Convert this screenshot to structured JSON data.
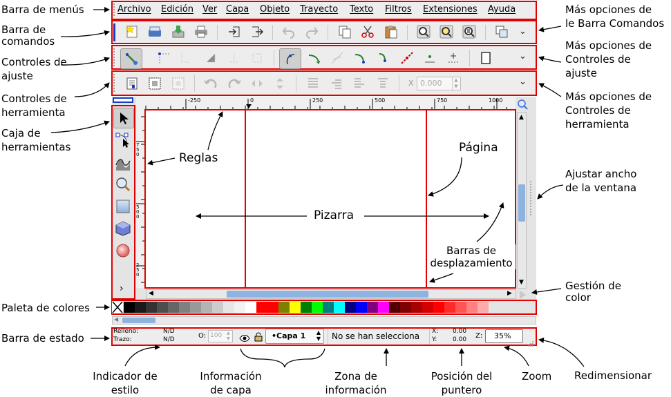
{
  "menu": {
    "items": [
      "Archivo",
      "Edición",
      "Ver",
      "Capa",
      "Objeto",
      "Trayecto",
      "Texto",
      "Filtros",
      "Extensiones",
      "Ayuda"
    ]
  },
  "ruler": {
    "h_ticks": [
      "-250",
      "0",
      "250",
      "500",
      "750",
      "1000"
    ],
    "v_ticks": [
      "750",
      "500",
      "250"
    ]
  },
  "tool_controls": {
    "x_label": "X",
    "x_value": "0.000"
  },
  "statusbar": {
    "fill_label": "Relleno:",
    "fill_value": "N/D",
    "stroke_label": "Trazo:",
    "stroke_value": "N/D",
    "opacity_label": "O:",
    "opacity_value": "100",
    "layer_name": "•Capa 1",
    "message": "No se han selecciona",
    "x_label": "X:",
    "x_value": "0.00",
    "y_label": "Y:",
    "y_value": "0.00",
    "zoom_label": "Z:",
    "zoom_value": "35%"
  },
  "palette": {
    "colors": [
      "#000000",
      "#1a1a1a",
      "#333333",
      "#4d4d4d",
      "#666666",
      "#808080",
      "#999999",
      "#b3b3b3",
      "#cccccc",
      "#e6e6e6",
      "#f2f2f2",
      "#ffffff",
      "#ff0000",
      "#ff0000",
      "#808000",
      "#ffff00",
      "#008000",
      "#00ff00",
      "#008080",
      "#00ffff",
      "#000080",
      "#0000ff",
      "#800080",
      "#ff00ff",
      "#550000",
      "#800000",
      "#aa0000",
      "#d40000",
      "#ff0000",
      "#ff2a2a",
      "#ff5555",
      "#ff8080",
      "#ffaaaa"
    ]
  },
  "annotations": {
    "left": {
      "menubar": "Barra de menús",
      "commands": "Barra de\ncomandos",
      "snap": "Controles de\najuste",
      "toolctrl": "Controles de\nherramienta",
      "toolbox": "Caja de\nherramientas",
      "palette": "Paleta de colores",
      "statusbar": "Barra de estado"
    },
    "right": {
      "commands_more": "Más opciones de\nle Barra Comandos",
      "snap_more": "Más opciones de\nControles de\najuste",
      "toolctrl_more": "Más opciones de\nControles de\nherramienta",
      "fit_window": "Ajustar ancho\nde la ventana",
      "color_mgmt": "Gestión de\ncolor",
      "resize": "Redimensionar"
    },
    "canvas": {
      "rulers": "Reglas",
      "page": "Página",
      "canvas": "Pizarra",
      "scrollbars": "Barras de\ndesplazamiento"
    },
    "bottom": {
      "style": "Indicador de\nestilo",
      "layer": "Información\nde capa",
      "info": "Zona de\ninformación",
      "pointer": "Posición del\npuntero",
      "zoom": "Zoom"
    }
  },
  "colors": {
    "accent_red": "#e00000",
    "chrome": "#ededed",
    "scroll_blue": "#8fb3e0"
  }
}
